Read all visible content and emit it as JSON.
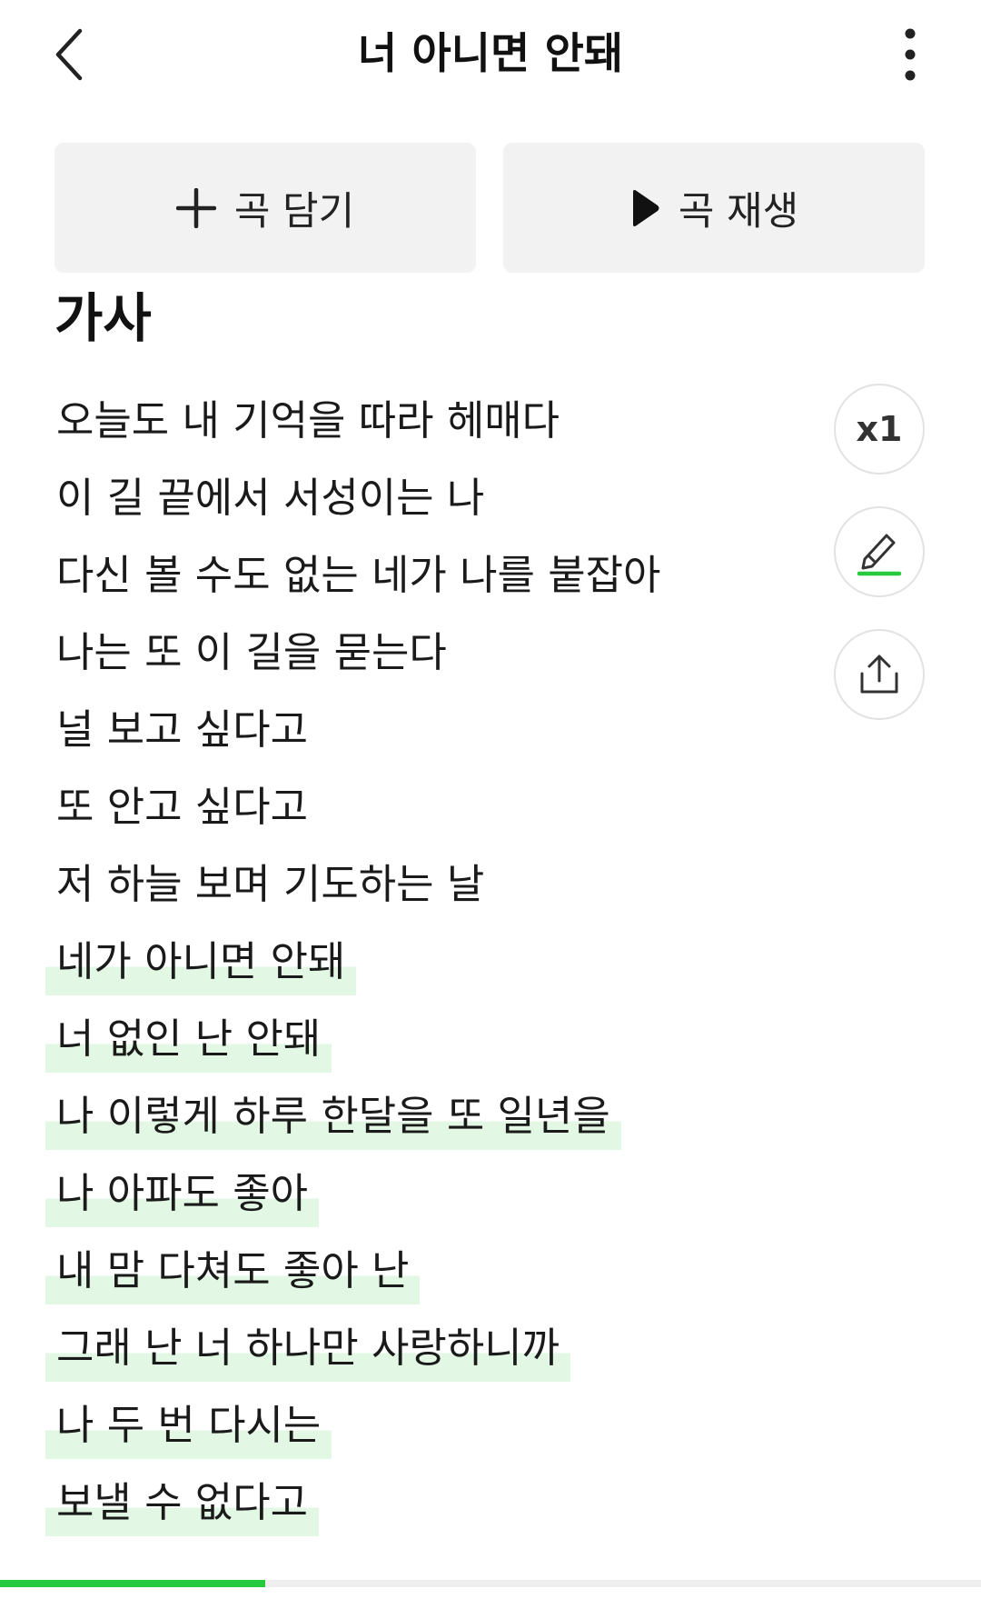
{
  "header": {
    "title": "너 아니면 안돼",
    "back_icon": "chevron-left-icon",
    "more_icon": "more-vertical-icon"
  },
  "actions": {
    "add_label": "곡 담기",
    "add_icon": "plus-icon",
    "play_label": "곡 재생",
    "play_icon": "play-icon"
  },
  "lyrics_section": {
    "title": "가사",
    "lines": [
      {
        "text": "오늘도 내 기억을 따라 헤매다",
        "highlighted": false
      },
      {
        "text": "이 길 끝에서 서성이는 나",
        "highlighted": false
      },
      {
        "text": "다신 볼 수도 없는 네가 나를 붙잡아",
        "highlighted": false
      },
      {
        "text": "나는 또 이 길을 묻는다",
        "highlighted": false
      },
      {
        "text": "널 보고 싶다고",
        "highlighted": false
      },
      {
        "text": "또 안고 싶다고",
        "highlighted": false
      },
      {
        "text": "저 하늘 보며 기도하는 날",
        "highlighted": false
      },
      {
        "text": "네가 아니면 안돼",
        "highlighted": true
      },
      {
        "text": "너 없인 난 안돼",
        "highlighted": true
      },
      {
        "text": "나 이렇게 하루 한달을 또 일년을",
        "highlighted": true
      },
      {
        "text": "나 아파도 좋아",
        "highlighted": true
      },
      {
        "text": "내 맘 다쳐도 좋아 난",
        "highlighted": true
      },
      {
        "text": "그래 난 너 하나만 사랑하니까",
        "highlighted": true
      },
      {
        "text": "나 두 번 다시는",
        "highlighted": true
      },
      {
        "text": "보낼 수 없다고",
        "highlighted": true
      }
    ]
  },
  "side_controls": {
    "speed_label": "x1",
    "highlight_icon": "highlighter-icon",
    "share_icon": "share-icon"
  },
  "progress": {
    "fraction": 0.27
  },
  "colors": {
    "accent": "#27c93f",
    "highlight_bg": "#e2f7e4",
    "button_bg": "#f2f2f2"
  }
}
